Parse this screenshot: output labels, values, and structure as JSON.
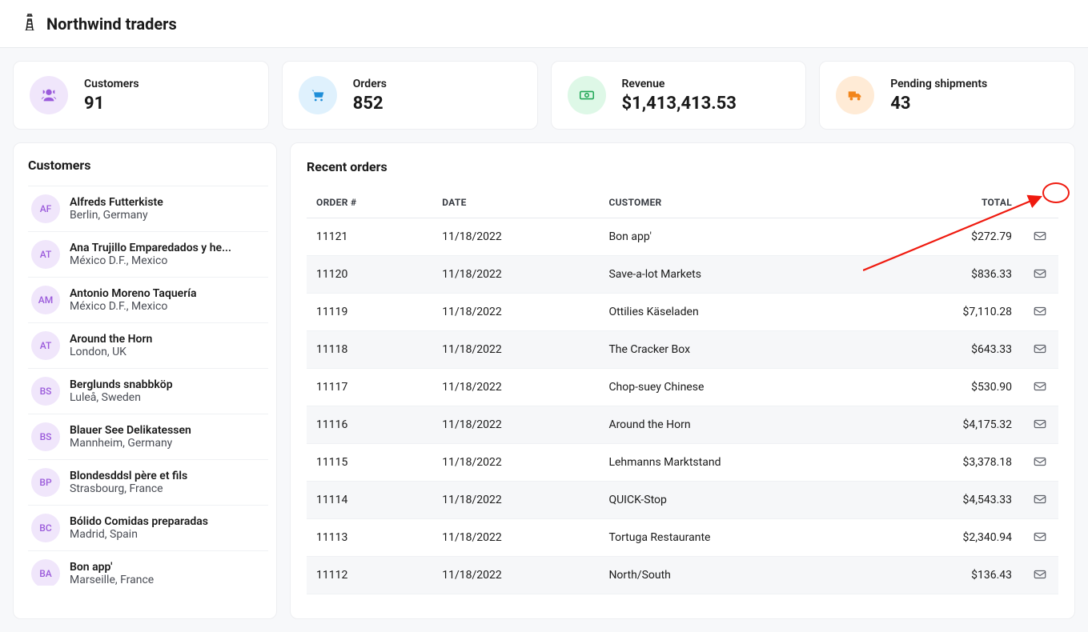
{
  "app": {
    "title": "Northwind traders"
  },
  "stats": {
    "customers": {
      "label": "Customers",
      "value": "91"
    },
    "orders": {
      "label": "Orders",
      "value": "852"
    },
    "revenue": {
      "label": "Revenue",
      "value": "$1,413,413.53"
    },
    "pending": {
      "label": "Pending shipments",
      "value": "43"
    }
  },
  "customers_panel": {
    "title": "Customers",
    "items": [
      {
        "initials": "AF",
        "name": "Alfreds Futterkiste",
        "location": "Berlin, Germany"
      },
      {
        "initials": "AT",
        "name": "Ana Trujillo Emparedados y he...",
        "location": "México D.F., Mexico"
      },
      {
        "initials": "AM",
        "name": "Antonio Moreno Taquería",
        "location": "México D.F., Mexico"
      },
      {
        "initials": "AT",
        "name": "Around the Horn",
        "location": "London, UK"
      },
      {
        "initials": "BS",
        "name": "Berglunds snabbköp",
        "location": "Luleå, Sweden"
      },
      {
        "initials": "BS",
        "name": "Blauer See Delikatessen",
        "location": "Mannheim, Germany"
      },
      {
        "initials": "BP",
        "name": "Blondesddsl père et fils",
        "location": "Strasbourg, France"
      },
      {
        "initials": "BC",
        "name": "Bólido Comidas preparadas",
        "location": "Madrid, Spain"
      },
      {
        "initials": "BA",
        "name": "Bon app'",
        "location": "Marseille, France"
      }
    ]
  },
  "orders_panel": {
    "title": "Recent orders",
    "columns": {
      "order": "ORDER #",
      "date": "DATE",
      "customer": "CUSTOMER",
      "total": "TOTAL"
    },
    "rows": [
      {
        "order": "11121",
        "date": "11/18/2022",
        "customer": "Bon app'",
        "total": "$272.79"
      },
      {
        "order": "11120",
        "date": "11/18/2022",
        "customer": "Save-a-lot Markets",
        "total": "$836.33"
      },
      {
        "order": "11119",
        "date": "11/18/2022",
        "customer": "Ottilies Käseladen",
        "total": "$7,110.28"
      },
      {
        "order": "11118",
        "date": "11/18/2022",
        "customer": "The Cracker Box",
        "total": "$643.33"
      },
      {
        "order": "11117",
        "date": "11/18/2022",
        "customer": "Chop-suey Chinese",
        "total": "$530.90"
      },
      {
        "order": "11116",
        "date": "11/18/2022",
        "customer": "Around the Horn",
        "total": "$4,175.32"
      },
      {
        "order": "11115",
        "date": "11/18/2022",
        "customer": "Lehmanns Marktstand",
        "total": "$3,378.18"
      },
      {
        "order": "11114",
        "date": "11/18/2022",
        "customer": "QUICK-Stop",
        "total": "$4,543.33"
      },
      {
        "order": "11113",
        "date": "11/18/2022",
        "customer": "Tortuga Restaurante",
        "total": "$2,340.94"
      },
      {
        "order": "11112",
        "date": "11/18/2022",
        "customer": "North/South",
        "total": "$136.43"
      }
    ]
  }
}
